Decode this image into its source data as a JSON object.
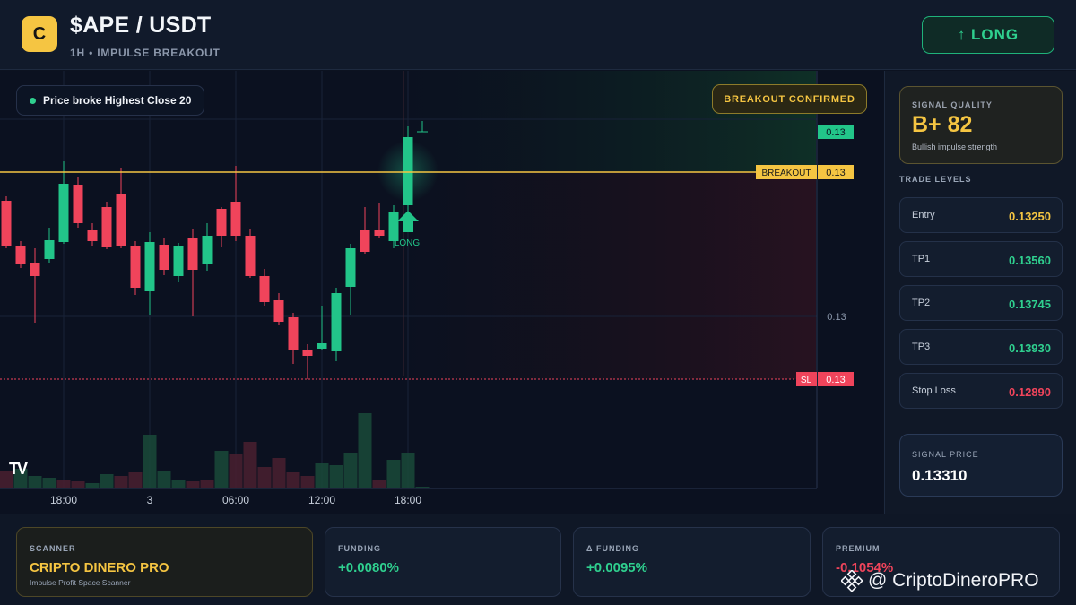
{
  "header": {
    "coin_icon_letter": "C",
    "pair": "$APE / USDT",
    "subtitle": "1H • IMPULSE BREAKOUT",
    "long_button": "↑ LONG"
  },
  "chart": {
    "price_pill": "Price broke Highest Close 20",
    "confirm_pill": "BREAKOUT CONFIRMED",
    "breakout_tag": "BREAKOUT",
    "breakout_price": "0.13",
    "top_price": "0.13",
    "mid_price": "0.13",
    "sl_tag": "SL",
    "sl_price": "0.13",
    "long_marker": "LONG",
    "tv_logo": "TV",
    "time_labels": [
      "18:00",
      "3",
      "06:00",
      "12:00",
      "18:00"
    ],
    "colors": {
      "up": "#22c589",
      "down": "#f0445b",
      "breakout": "#f5c542",
      "sl": "#f0445b"
    }
  },
  "signal_quality": {
    "label": "SIGNAL QUALITY",
    "grade": "B+ 82",
    "description": "Bullish impulse strength"
  },
  "trade_levels": {
    "title": "TRADE LEVELS",
    "items": [
      {
        "name": "Entry",
        "value": "0.13250",
        "color": "#f5c542"
      },
      {
        "name": "TP1",
        "value": "0.13560",
        "color": "#2fd08f"
      },
      {
        "name": "TP2",
        "value": "0.13745",
        "color": "#2fd08f"
      },
      {
        "name": "TP3",
        "value": "0.13930",
        "color": "#2fd08f"
      },
      {
        "name": "Stop Loss",
        "value": "0.12890",
        "color": "#f0445b"
      }
    ]
  },
  "signal_price": {
    "label": "SIGNAL PRICE",
    "value": "0.13310"
  },
  "bottom": {
    "scanner": {
      "label": "SCANNER",
      "value": "CRIPTO DINERO PRO",
      "sub": "Impulse Profit Space Scanner"
    },
    "funding": {
      "label": "FUNDING",
      "value": "+0.0080%"
    },
    "delta_funding": {
      "label": "Δ FUNDING",
      "value": "+0.0095%"
    },
    "premium": {
      "label": "PREMIUM",
      "value": "-0.1054%"
    },
    "watermark": "@ CriptoDineroPRO"
  }
}
